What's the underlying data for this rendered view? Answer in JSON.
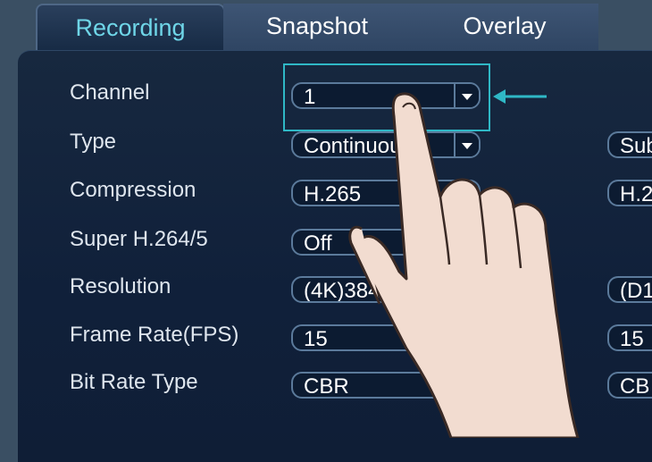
{
  "tabs": [
    {
      "label": "Recording",
      "active": true
    },
    {
      "label": "Snapshot",
      "active": false
    },
    {
      "label": "Overlay",
      "active": false
    }
  ],
  "fields": [
    {
      "label": "Channel",
      "value": "1",
      "dropdown": true
    },
    {
      "label": "Type",
      "value": "Continuous",
      "dropdown": true,
      "sub_value": "Sub"
    },
    {
      "label": "Compression",
      "value": "H.265",
      "sub_value": "H.2"
    },
    {
      "label": "Super H.264/5",
      "value": "Off"
    },
    {
      "label": "Resolution",
      "value": "(4K)3840x2160",
      "sub_value": "(D1"
    },
    {
      "label": "Frame Rate(FPS)",
      "value": "15",
      "sub_value": "15"
    },
    {
      "label": "Bit Rate Type",
      "value": "CBR",
      "sub_value": "CB"
    }
  ],
  "colors": {
    "active_tab_text": "#6fd6e8",
    "highlight": "#2fb8c6",
    "panel_bg": "#10203a"
  },
  "icons": {
    "pointer": "pointing-hand-icon",
    "arrow": "arrow-left-icon",
    "dropdown": "chevron-down-icon"
  }
}
